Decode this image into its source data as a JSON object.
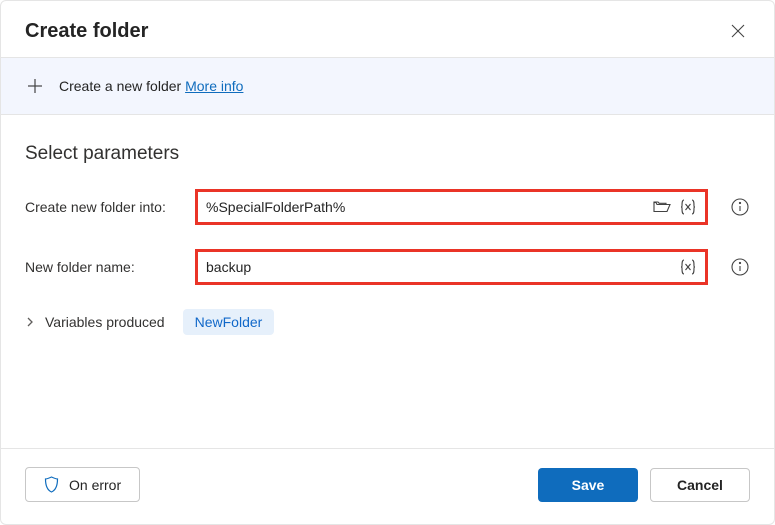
{
  "header": {
    "title": "Create folder"
  },
  "banner": {
    "text": "Create a new folder ",
    "link": "More info"
  },
  "section": {
    "title": "Select parameters"
  },
  "fields": {
    "folderInto": {
      "label": "Create new folder into:",
      "value": "%SpecialFolderPath%"
    },
    "folderName": {
      "label": "New folder name:",
      "value": "backup"
    }
  },
  "variables": {
    "label": "Variables produced",
    "chip": "NewFolder"
  },
  "footer": {
    "onError": "On error",
    "save": "Save",
    "cancel": "Cancel"
  }
}
